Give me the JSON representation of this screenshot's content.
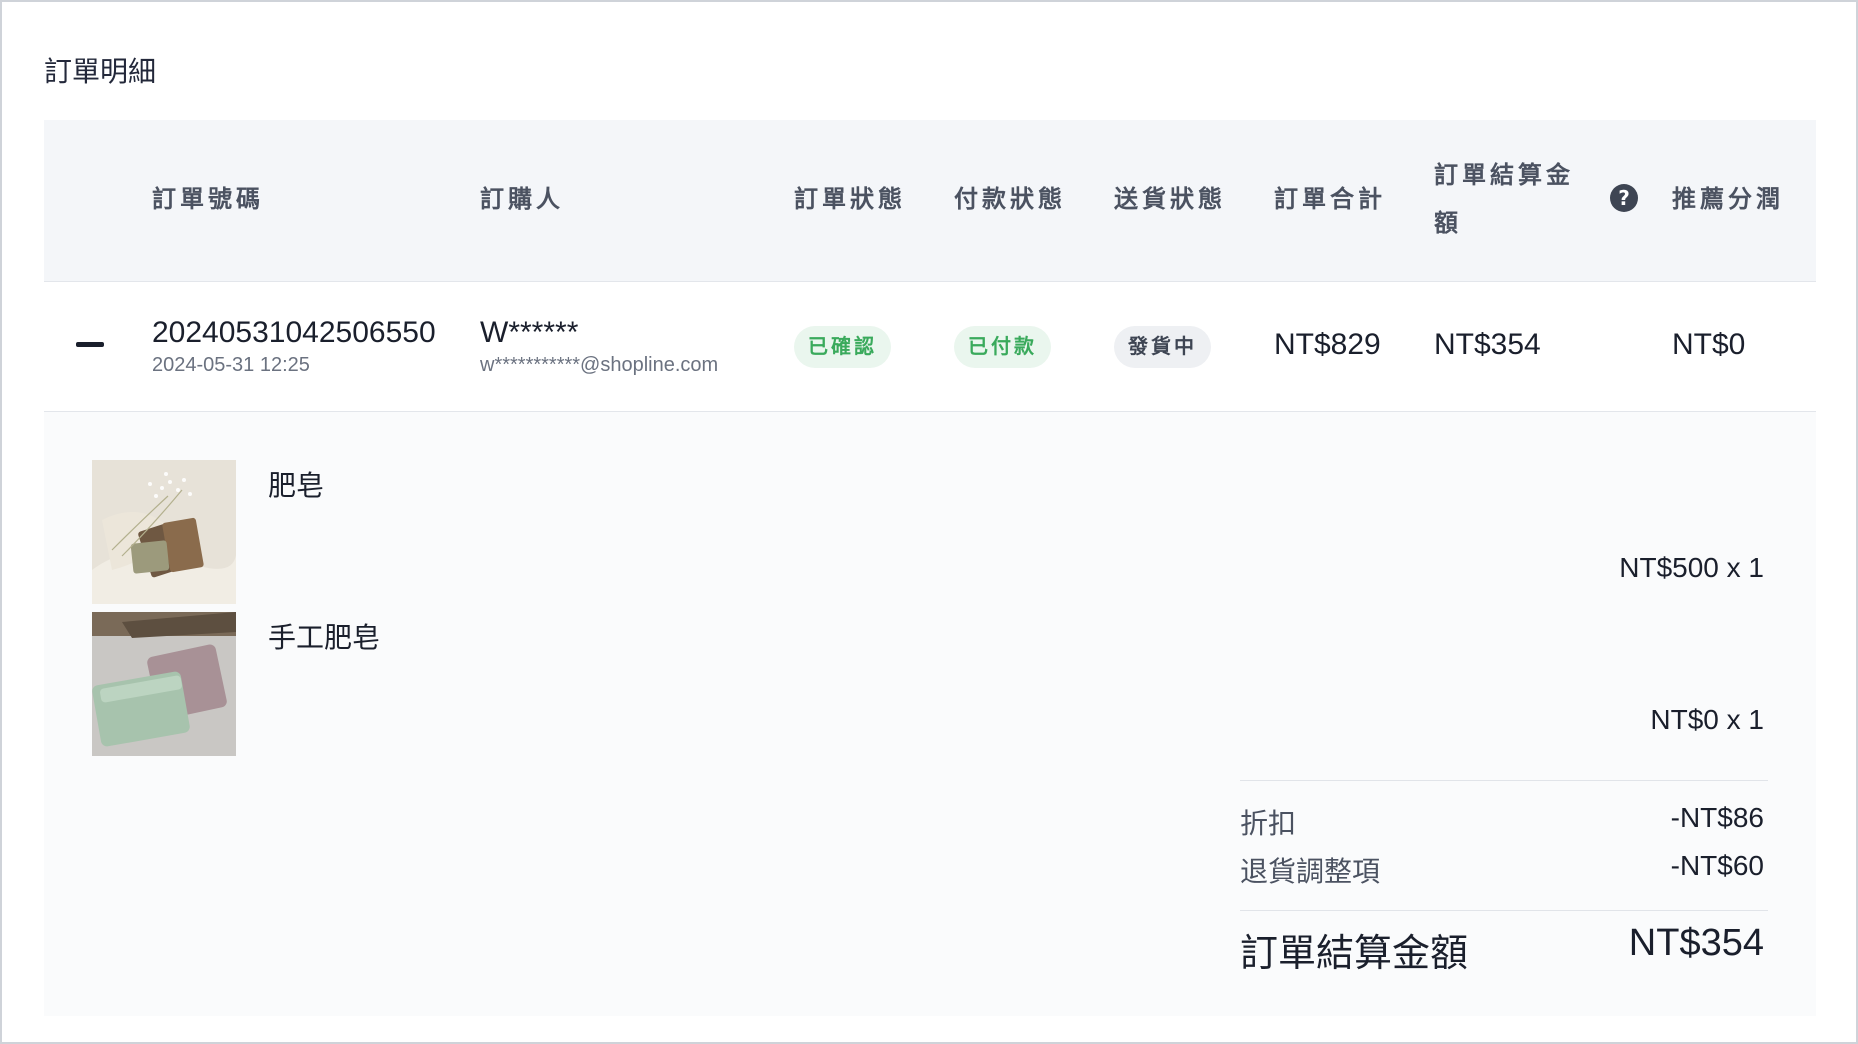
{
  "page": {
    "title": "訂單明細"
  },
  "columns": {
    "order_no": "訂單號碼",
    "buyer": "訂購人",
    "order_status": "訂單狀態",
    "payment_status": "付款狀態",
    "delivery_status": "送貨狀態",
    "order_total": "訂單合計",
    "settlement_line1": "訂單結算金",
    "settlement_line2": "額",
    "help_icon": "?",
    "referral": "推薦分潤"
  },
  "order": {
    "number": "20240531042506550",
    "date": "2024-05-31 12:25",
    "buyer_name": "W******",
    "buyer_email": "w***********@shopline.com",
    "order_status": "已確認",
    "payment_status": "已付款",
    "delivery_status": "發貨中",
    "order_total": "NT$829",
    "settlement_amount": "NT$354",
    "referral": "NT$0"
  },
  "items": [
    {
      "name": "肥皂",
      "price": "NT$500 x 1",
      "image": "soap-photo"
    },
    {
      "name": "手工肥皂",
      "price": "NT$0 x 1",
      "image": "handmade-soap-photo"
    }
  ],
  "summary": {
    "discount_label": "折扣",
    "discount_value": "-NT$86",
    "return_label": "退貨調整項",
    "return_value": "-NT$60",
    "total_label": "訂單結算金額",
    "total_value": "NT$354"
  },
  "colors": {
    "header_bg": "#f4f6f9",
    "badge_green_bg": "#eaf6ee",
    "badge_green_text": "#3aaa5c",
    "badge_gray_bg": "#eef0f3"
  }
}
